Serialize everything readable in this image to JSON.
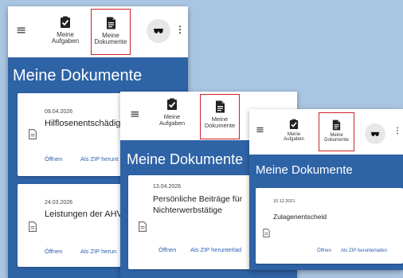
{
  "panels": [
    {
      "nav": [
        {
          "label_line1": "Meine",
          "label_line2": "Aufgaben",
          "icon": "clipboard-check-icon"
        },
        {
          "label_line1": "Meine",
          "label_line2": "Dokumente",
          "icon": "document-icon"
        }
      ],
      "title": "Meine Dokumente",
      "cards": [
        {
          "date": "09.04.2026",
          "title": "Hilflosenentschädigu",
          "actions": [
            "Öffnen",
            "Als ZIP herunt"
          ]
        },
        {
          "date": "24.03.2026",
          "title": "Leistungen der AHV",
          "actions": [
            "Öffnen",
            "Als ZIP herun"
          ]
        }
      ]
    },
    {
      "nav": [
        {
          "label_line1": "Meine",
          "label_line2": "Aufgaben",
          "icon": "clipboard-check-icon"
        },
        {
          "label_line1": "Meine",
          "label_line2": "Dokumente",
          "icon": "document-icon"
        }
      ],
      "title": "Meine Dokumente",
      "cards": [
        {
          "date": "13.04.2026",
          "title_line1": "Persönliche Beiträge für",
          "title_line2": "Nichterwerbstätige",
          "actions": [
            "Öffnen",
            "Als ZIP herunterlad"
          ]
        }
      ]
    },
    {
      "nav": [
        {
          "label_line1": "Meine",
          "label_line2": "Aufgaben",
          "icon": "clipboard-check-icon"
        },
        {
          "label_line1": "Meine",
          "label_line2": "Dokumente",
          "icon": "document-icon"
        }
      ],
      "title": "Meine Dokumente",
      "cards": [
        {
          "date": "10.12.2021",
          "title": "Zulagenentscheid",
          "actions": [
            "Öffnen",
            "Als ZIP herunterladen"
          ]
        }
      ]
    }
  ],
  "colors": {
    "panel_blue": "#2e63a6",
    "active_border": "#cc2229",
    "link": "#2a5db0",
    "background": "#a9c5e2"
  }
}
